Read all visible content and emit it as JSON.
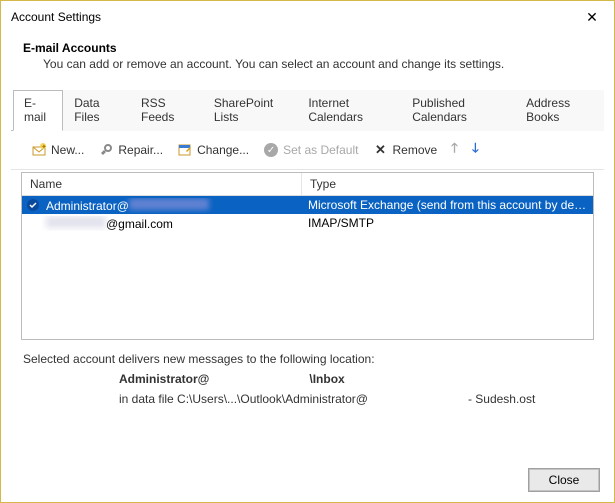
{
  "window": {
    "title": "Account Settings"
  },
  "header": {
    "heading": "E-mail Accounts",
    "sub": "You can add or remove an account. You can select an account and change its settings."
  },
  "tabs": [
    {
      "label": "E-mail"
    },
    {
      "label": "Data Files"
    },
    {
      "label": "RSS Feeds"
    },
    {
      "label": "SharePoint Lists"
    },
    {
      "label": "Internet Calendars"
    },
    {
      "label": "Published Calendars"
    },
    {
      "label": "Address Books"
    }
  ],
  "toolbar": {
    "new": "New...",
    "repair": "Repair...",
    "change": "Change...",
    "set_default": "Set as Default",
    "remove": "Remove"
  },
  "columns": {
    "name": "Name",
    "type": "Type"
  },
  "accounts": [
    {
      "name_prefix": "Administrator@",
      "name_rest_hidden": true,
      "type": "Microsoft Exchange (send from this account by def...",
      "selected": true,
      "default": true
    },
    {
      "name_prefix": "",
      "name_suffix": "@gmail.com",
      "name_rest_hidden": true,
      "type": "IMAP/SMTP",
      "selected": false,
      "default": false
    }
  ],
  "info": {
    "line1": "Selected account delivers new messages to the following location:",
    "loc_prefix": "Administrator@",
    "loc_suffix": "\\Inbox",
    "path_prefix": "in data file C:\\Users\\...\\Outlook\\Administrator@",
    "path_suffix": " - Sudesh.ost"
  },
  "buttons": {
    "close": "Close"
  }
}
